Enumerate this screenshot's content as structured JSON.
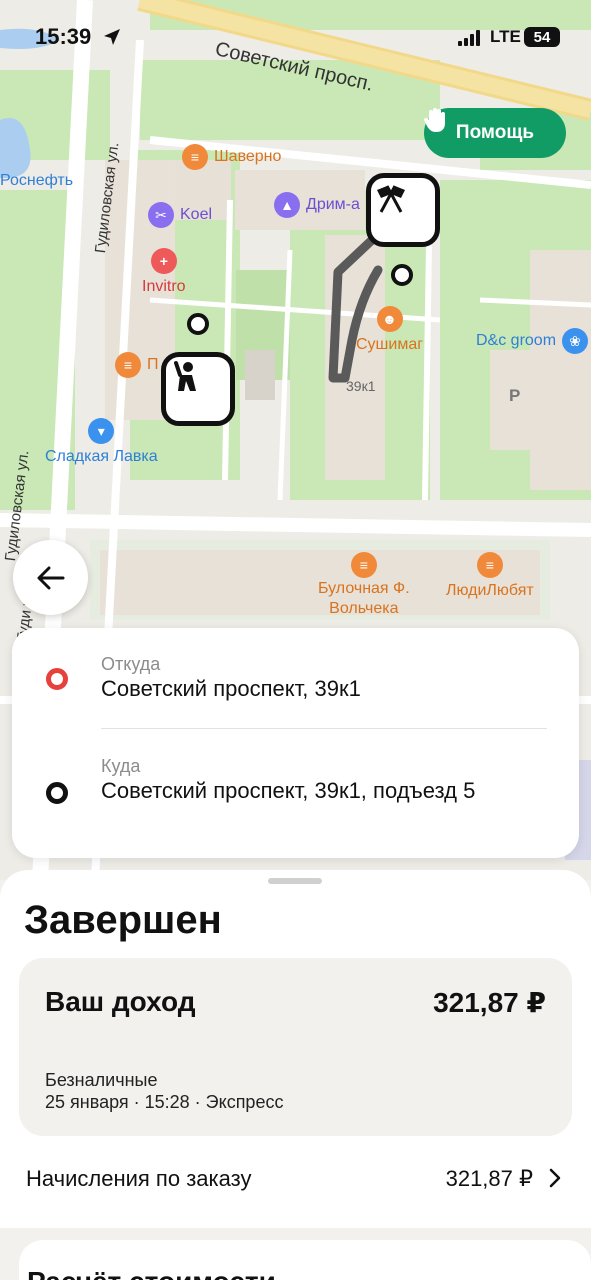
{
  "status_bar": {
    "time": "15:39",
    "network": "LTE",
    "battery": "54"
  },
  "map": {
    "streets": {
      "main": "Советский просп.",
      "vertical_1": "Гудиловская ул.",
      "vertical_2": "Гудиловская ул.",
      "vertical_3": "Гуди ул."
    },
    "pois": {
      "rosneft": "Роснефть",
      "shaverno": "Шаверно",
      "koel": "Koel",
      "drim": "Дрим-а",
      "invitro": "Invitro",
      "p": "П",
      "sushimag": "Сушимаг",
      "dc_groom": "D&c groom",
      "sladkaya": "Сладкая Лавка",
      "bulochnaya_1": "Булочная Ф.",
      "bulochnaya_2": "Вольчека",
      "lyudi": "ЛюдиЛюбят",
      "house": "39к1",
      "parking": "P"
    },
    "help_button": "Помощь"
  },
  "route": {
    "from": {
      "label": "Откуда",
      "address": "Советский проспект, 39к1",
      "pin_color": "#e8413c"
    },
    "to": {
      "label": "Куда",
      "address": "Советский проспект, 39к1, подъезд 5",
      "pin_color": "#111111"
    }
  },
  "order": {
    "status": "Завершен",
    "income": {
      "label": "Ваш доход",
      "amount": "321,87 ₽",
      "payment": "Безналичные",
      "meta": "25 января · 15:28 · Экспресс"
    },
    "charges": {
      "label": "Начисления по заказу",
      "amount": "321,87 ₽"
    },
    "next_section": "Расчёт стоимости"
  },
  "colors": {
    "accent_green": "#109c64",
    "map_green": "#c8e6b4",
    "map_building": "#e7e1d8"
  }
}
